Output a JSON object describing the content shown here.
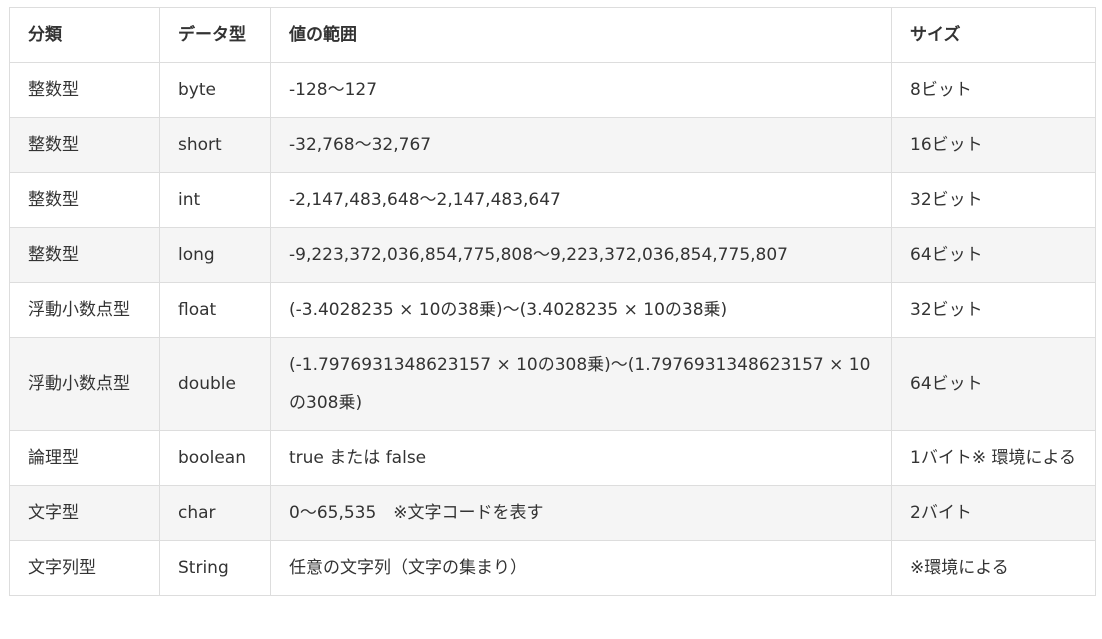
{
  "table": {
    "headers": [
      "分類",
      "データ型",
      "値の範囲",
      "サイズ"
    ],
    "rows": [
      {
        "category": "整数型",
        "type": "byte",
        "range": "-128〜127",
        "size": "8ビット"
      },
      {
        "category": "整数型",
        "type": "short",
        "range": "-32,768〜32,767",
        "size": "16ビット"
      },
      {
        "category": "整数型",
        "type": "int",
        "range": "-2,147,483,648〜2,147,483,647",
        "size": "32ビット"
      },
      {
        "category": "整数型",
        "type": "long",
        "range": "-9,223,372,036,854,775,808〜9,223,372,036,854,775,807",
        "size": "64ビット"
      },
      {
        "category": "浮動小数点型",
        "type": "float",
        "range": "(-3.4028235 × 10の38乗)〜(3.4028235 × 10の38乗)",
        "size": "32ビット"
      },
      {
        "category": "浮動小数点型",
        "type": "double",
        "range": "(-1.7976931348623157 × 10の308乗)〜(1.7976931348623157 × 10の308乗)",
        "size": "64ビット"
      },
      {
        "category": "論理型",
        "type": "boolean",
        "range": "true または false",
        "size": "1バイト※ 環境による"
      },
      {
        "category": "文字型",
        "type": "char",
        "range": "0〜65,535　※文字コードを表す",
        "size": "2バイト"
      },
      {
        "category": "文字列型",
        "type": "String",
        "range": "任意の文字列（文字の集まり）",
        "size": "※環境による"
      }
    ]
  }
}
